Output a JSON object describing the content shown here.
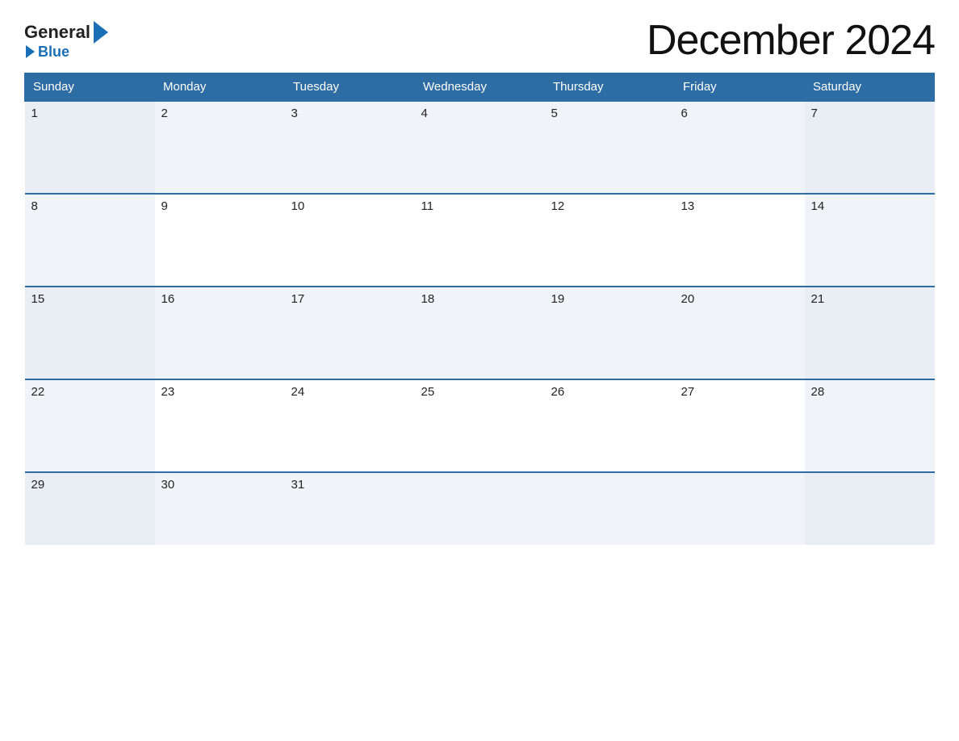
{
  "logo": {
    "general_text": "General",
    "blue_text": "Blue"
  },
  "header": {
    "title": "December 2024"
  },
  "calendar": {
    "days_of_week": [
      "Sunday",
      "Monday",
      "Tuesday",
      "Wednesday",
      "Thursday",
      "Friday",
      "Saturday"
    ],
    "weeks": [
      [
        {
          "date": "1",
          "active": true
        },
        {
          "date": "2",
          "active": true
        },
        {
          "date": "3",
          "active": true
        },
        {
          "date": "4",
          "active": true
        },
        {
          "date": "5",
          "active": true
        },
        {
          "date": "6",
          "active": true
        },
        {
          "date": "7",
          "active": true
        }
      ],
      [
        {
          "date": "8",
          "active": true
        },
        {
          "date": "9",
          "active": true
        },
        {
          "date": "10",
          "active": true
        },
        {
          "date": "11",
          "active": true
        },
        {
          "date": "12",
          "active": true
        },
        {
          "date": "13",
          "active": true
        },
        {
          "date": "14",
          "active": true
        }
      ],
      [
        {
          "date": "15",
          "active": true
        },
        {
          "date": "16",
          "active": true
        },
        {
          "date": "17",
          "active": true
        },
        {
          "date": "18",
          "active": true
        },
        {
          "date": "19",
          "active": true
        },
        {
          "date": "20",
          "active": true
        },
        {
          "date": "21",
          "active": true
        }
      ],
      [
        {
          "date": "22",
          "active": true
        },
        {
          "date": "23",
          "active": true
        },
        {
          "date": "24",
          "active": true
        },
        {
          "date": "25",
          "active": true
        },
        {
          "date": "26",
          "active": true
        },
        {
          "date": "27",
          "active": true
        },
        {
          "date": "28",
          "active": true
        }
      ],
      [
        {
          "date": "29",
          "active": true
        },
        {
          "date": "30",
          "active": true
        },
        {
          "date": "31",
          "active": true
        },
        {
          "date": "",
          "active": false
        },
        {
          "date": "",
          "active": false
        },
        {
          "date": "",
          "active": false
        },
        {
          "date": "",
          "active": false
        }
      ]
    ]
  }
}
